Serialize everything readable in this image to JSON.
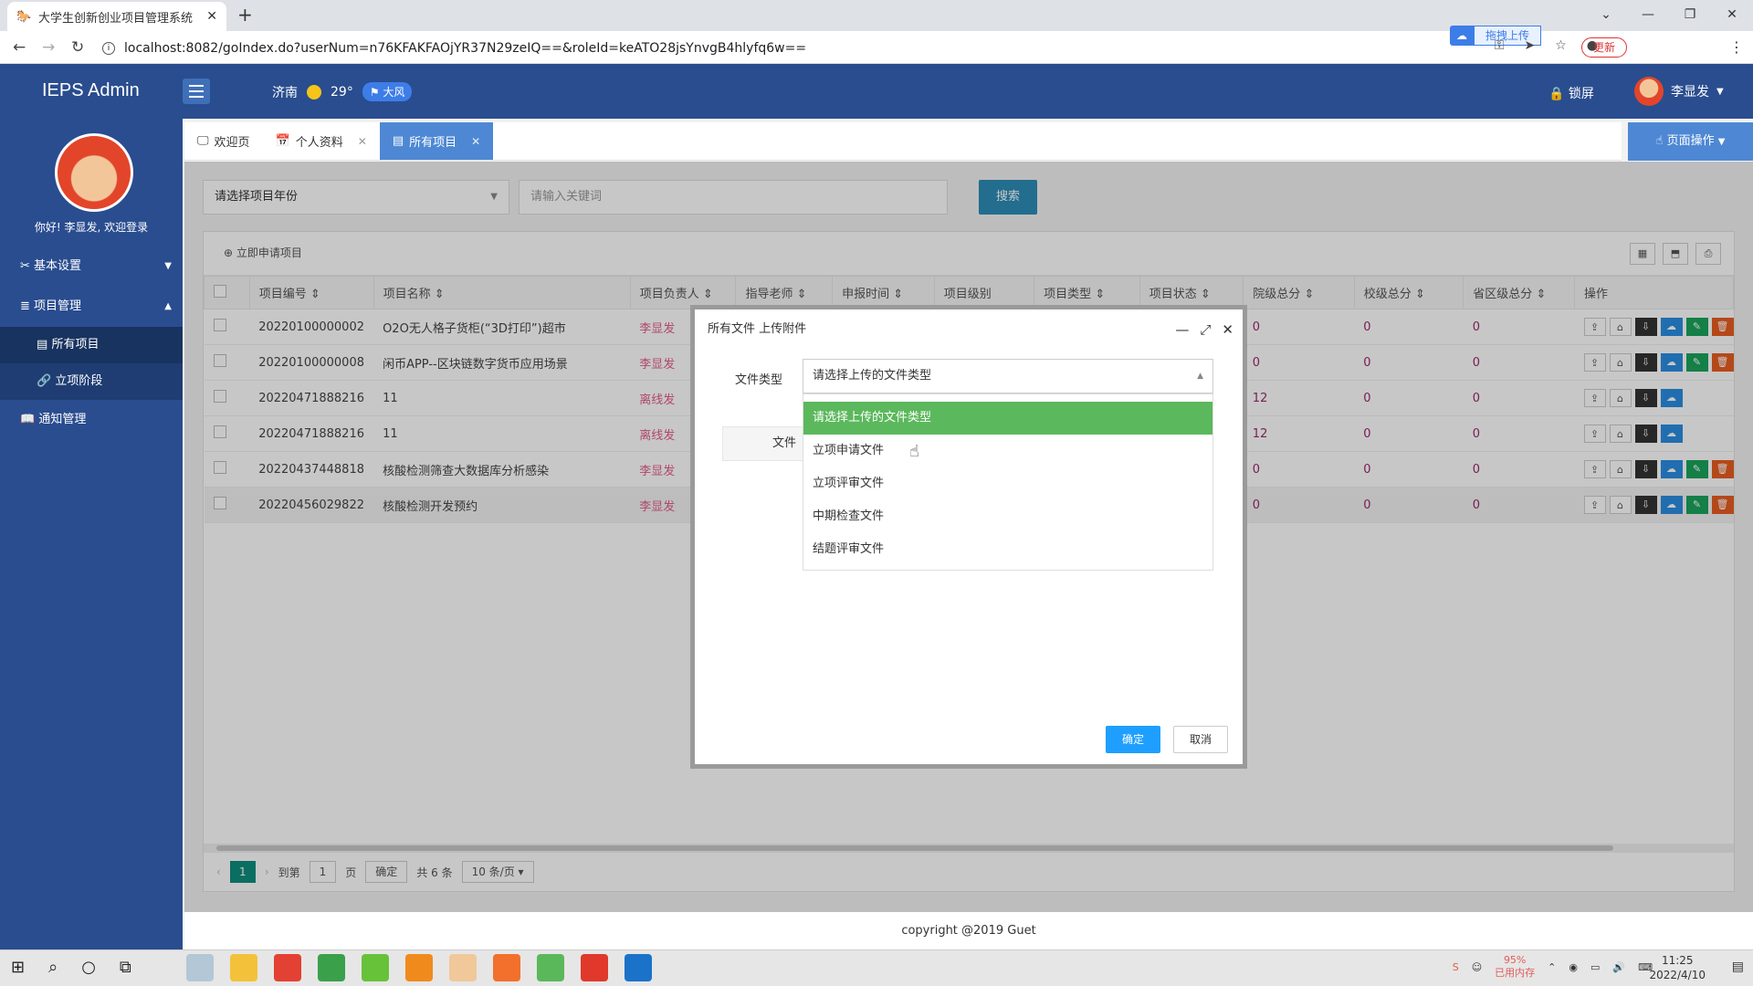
{
  "browser": {
    "tab_title": "大学生创新创业项目管理系统",
    "url": "localhost:8082/goIndex.do?userNum=n76KFAKFAOjYR37N29zeIQ==&roleId=keATO28jsYnvgB4hlyfq6w==",
    "upload_label": "拖拽上传",
    "update_label": "更新"
  },
  "header": {
    "logo": "IEPS Admin",
    "city": "济南",
    "temp": "29°",
    "wind": "大风",
    "lock": "锁屏",
    "user": "李显发"
  },
  "sidebar": {
    "greeting": "你好!  李显发, 欢迎登录",
    "items": [
      {
        "label": "基本设置"
      },
      {
        "label": "项目管理"
      },
      {
        "label": "所有项目"
      },
      {
        "label": "立项阶段"
      },
      {
        "label": "通知管理"
      }
    ]
  },
  "tabs": [
    {
      "label": "欢迎页"
    },
    {
      "label": "个人资料"
    },
    {
      "label": "所有项目"
    }
  ],
  "page_op": "页面操作",
  "filters": {
    "year_placeholder": "请选择项目年份",
    "keyword_placeholder": "请输入关键词",
    "search": "搜索"
  },
  "toolbar": {
    "apply": "立即申请项目"
  },
  "table": {
    "headers": [
      "项目编号",
      "项目名称",
      "项目负责人",
      "指导老师",
      "申报时间",
      "项目级别",
      "项目类型",
      "项目状态",
      "院级总分",
      "校级总分",
      "省区级总分",
      "操作"
    ],
    "rows": [
      {
        "id": "20220100000002",
        "name": "O2O无人格子货柜(“3D打印”)超市",
        "owner": "李显发",
        "s1": "0",
        "s2": "0",
        "s3": "0"
      },
      {
        "id": "20220100000008",
        "name": "闲币APP--区块链数字货币应用场景",
        "owner": "李显发",
        "s1": "0",
        "s2": "0",
        "s3": "0"
      },
      {
        "id": "20220471888216",
        "name": "11",
        "owner": "离线发",
        "s1": "12",
        "s2": "0",
        "s3": "0"
      },
      {
        "id": "20220471888216",
        "name": "11",
        "owner": "离线发",
        "s1": "12",
        "s2": "0",
        "s3": "0"
      },
      {
        "id": "20220437448818",
        "name": "核酸检测筛查大数据库分析感染",
        "owner": "李显发",
        "s1": "0",
        "s2": "0",
        "s3": "0"
      },
      {
        "id": "20220456029822",
        "name": "核酸检测开发预约",
        "owner": "李显发",
        "s1": "0",
        "s2": "0",
        "s3": "0"
      }
    ]
  },
  "pager": {
    "page": "1",
    "goto": "到第",
    "page_input": "1",
    "page_unit": "页",
    "confirm": "确定",
    "total": "共 6 条",
    "per_page": "10 条/页"
  },
  "footer": "copyright @2019 Guet",
  "modal": {
    "title": "所有文件 上传附件",
    "file_type_label": "文件类型",
    "select_value": "请选择上传的文件类型",
    "file_row_label": "文件名",
    "options": [
      "请选择上传的文件类型",
      "立项申请文件",
      "立项评审文件",
      "中期检查文件",
      "结题评审文件"
    ],
    "ok": "确定",
    "cancel": "取消"
  },
  "taskbar": {
    "mem_pct": "95%",
    "mem_label": "已用内存",
    "time": "11:25",
    "date": "2022/4/10"
  }
}
